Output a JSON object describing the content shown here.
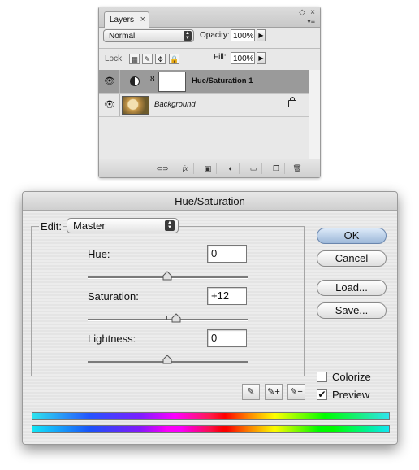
{
  "layers_panel": {
    "tab_label": "Layers",
    "tab_close": "×",
    "close_glyph": "×",
    "minimize_glyph": "◇",
    "menu_glyph": "▾≡",
    "blend_mode": "Normal",
    "opacity_label": "Opacity:",
    "opacity_value": "100%",
    "lock_label": "Lock:",
    "fill_label": "Fill:",
    "fill_value": "100%",
    "layers": [
      {
        "name": "Hue/Saturation 1",
        "visible_glyph": "👁",
        "chain_glyph": "8"
      },
      {
        "name": "Background",
        "visible_glyph": "👁"
      }
    ],
    "footer_icons": [
      "link-icon",
      "fx-icon",
      "mask-icon",
      "adjustment-icon",
      "folder-icon",
      "new-layer-icon",
      "trash-icon"
    ],
    "fx_text": "fx"
  },
  "dialog": {
    "title": "Hue/Saturation",
    "edit_label": "Edit:",
    "edit_value": "Master",
    "hue_label": "Hue:",
    "hue_value": "0",
    "saturation_label": "Saturation:",
    "saturation_value": "+12",
    "lightness_label": "Lightness:",
    "lightness_value": "0",
    "ok_label": "OK",
    "cancel_label": "Cancel",
    "load_label": "Load...",
    "save_label": "Save...",
    "colorize_label": "Colorize",
    "colorize_checked": false,
    "preview_label": "Preview",
    "preview_checked": true,
    "check_glyph": "✔"
  },
  "colors": {
    "selected_row": "#9a9a9a",
    "ok_button": "#9db8d9"
  }
}
